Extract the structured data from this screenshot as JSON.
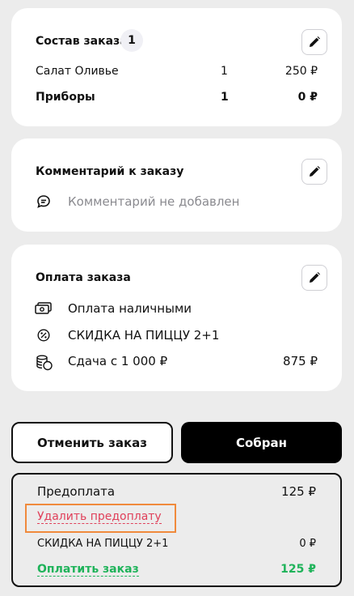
{
  "order": {
    "title": "Состав заказа",
    "count": "1",
    "items": [
      {
        "name": "Салат Оливье",
        "qty": "1",
        "price": "250 ₽"
      },
      {
        "name": "Приборы",
        "qty": "1",
        "price": "0 ₽"
      }
    ]
  },
  "comment": {
    "title": "Комментарий к заказу",
    "placeholder": "Комментарий не добавлен"
  },
  "payment": {
    "title": "Оплата заказа",
    "method": "Оплата наличными",
    "discount": "СКИДКА НА ПИЦЦУ 2+1",
    "change_label": "Сдача с 1 000 ₽",
    "change_value": "875 ₽"
  },
  "actions": {
    "cancel_label": "Отменить заказ",
    "collected_label": "Собран"
  },
  "summary": {
    "prepayment_label": "Предоплата",
    "prepayment_value": "125 ₽",
    "remove_prepayment": "Удалить предоплату",
    "discount_label": "СКИДКА НА ПИЦЦУ 2+1",
    "discount_value": "0 ₽",
    "pay_label": "Оплатить заказ",
    "pay_value": "125 ₽"
  },
  "colors": {
    "accent_green": "#1fb35a",
    "danger_red": "#e0405a",
    "highlight_orange": "#f08a3c"
  },
  "icons": [
    "pencil-icon",
    "chat-icon",
    "cash-icon",
    "percent-icon",
    "coins-icon"
  ]
}
